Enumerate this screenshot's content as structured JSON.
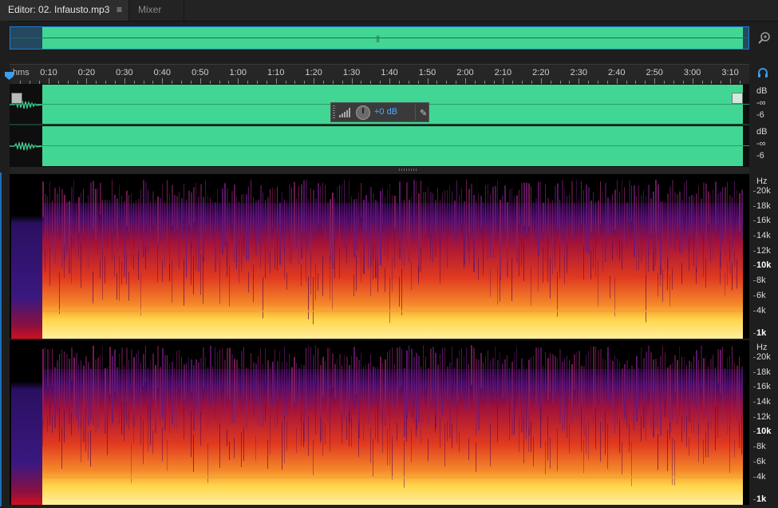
{
  "tabs": {
    "editor_label": "Editor: 02. Infausto.mp3",
    "editor_menu": "≡",
    "mixer_label": "Mixer"
  },
  "overview": {
    "grip": "|||"
  },
  "ruler": {
    "units": "hms",
    "labels": [
      "0:10",
      "0:20",
      "0:30",
      "0:40",
      "0:50",
      "1:00",
      "1:10",
      "1:20",
      "1:30",
      "1:40",
      "1:50",
      "2:00",
      "2:10",
      "2:20",
      "2:30",
      "2:40",
      "2:50",
      "3:00",
      "3:10"
    ]
  },
  "hud": {
    "value": "+0 dB"
  },
  "db_scale": {
    "unit": "dB",
    "neg_inf": "-∞",
    "minus6": "-6"
  },
  "hz_scale": {
    "unit": "Hz",
    "labels": [
      "20k",
      "18k",
      "16k",
      "14k",
      "12k",
      "10k",
      "8k",
      "6k",
      "4k",
      "1k"
    ]
  },
  "colors": {
    "waveform": "#42d694",
    "selection_border": "#1a7fd6",
    "hud_value": "#4fa9ff"
  },
  "icons": {
    "zoom": "zoom-icon",
    "headphone": "headphone-icon",
    "pin": "pin-icon",
    "volume": "volume-bars-icon"
  }
}
